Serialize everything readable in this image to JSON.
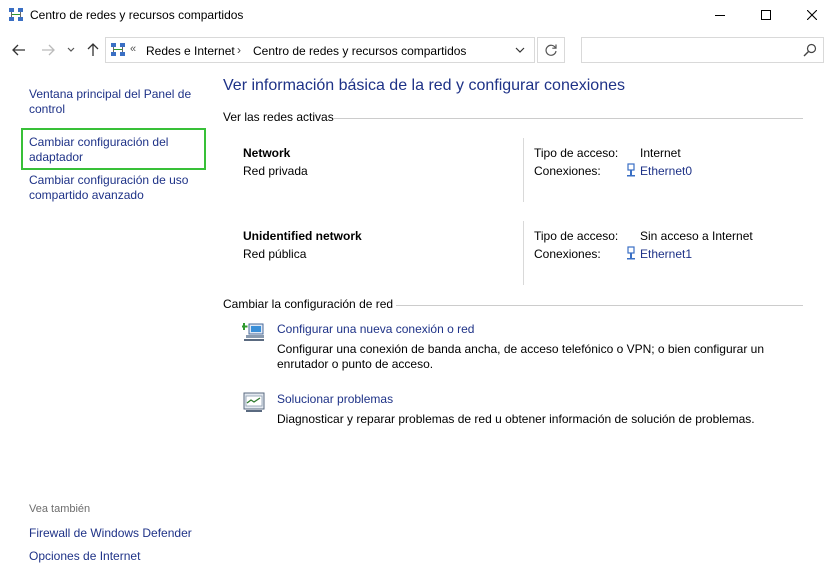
{
  "window": {
    "title": "Centro de redes y recursos compartidos"
  },
  "address": {
    "overflow": "«",
    "crumb1": "Redes e Internet",
    "separator": "›",
    "crumb2": "Centro de redes y recursos compartidos",
    "search_placeholder": ""
  },
  "sidebar": {
    "links": [
      "Ventana principal del Panel de control",
      "Cambiar configuración del adaptador",
      "Cambiar configuración de uso compartido avanzado"
    ],
    "see_also_label": "Vea también",
    "see_also": [
      "Firewall de Windows Defender",
      "Opciones de Internet"
    ]
  },
  "main": {
    "title": "Ver información básica de la red y configurar conexiones",
    "active_networks_label": "Ver las redes activas",
    "networks": [
      {
        "name": "Network",
        "type": "Red privada",
        "access_label": "Tipo de acceso:",
        "access_value": "Internet",
        "connections_label": "Conexiones:",
        "connection": "Ethernet0"
      },
      {
        "name": "Unidentified network",
        "type": "Red pública",
        "access_label": "Tipo de acceso:",
        "access_value": "Sin acceso a Internet",
        "connections_label": "Conexiones:",
        "connection": "Ethernet1"
      }
    ],
    "change_settings_label": "Cambiar la configuración de red",
    "tasks": [
      {
        "link": "Configurar una nueva conexión o red",
        "description": "Configurar una conexión de banda ancha, de acceso telefónico o VPN; o bien configurar un enrutador o punto de acceso."
      },
      {
        "link": "Solucionar problemas",
        "description": "Diagnosticar y reparar problemas de red u obtener información de solución de problemas."
      }
    ]
  },
  "colors": {
    "link": "#1e3287",
    "highlight": "#38c038"
  }
}
